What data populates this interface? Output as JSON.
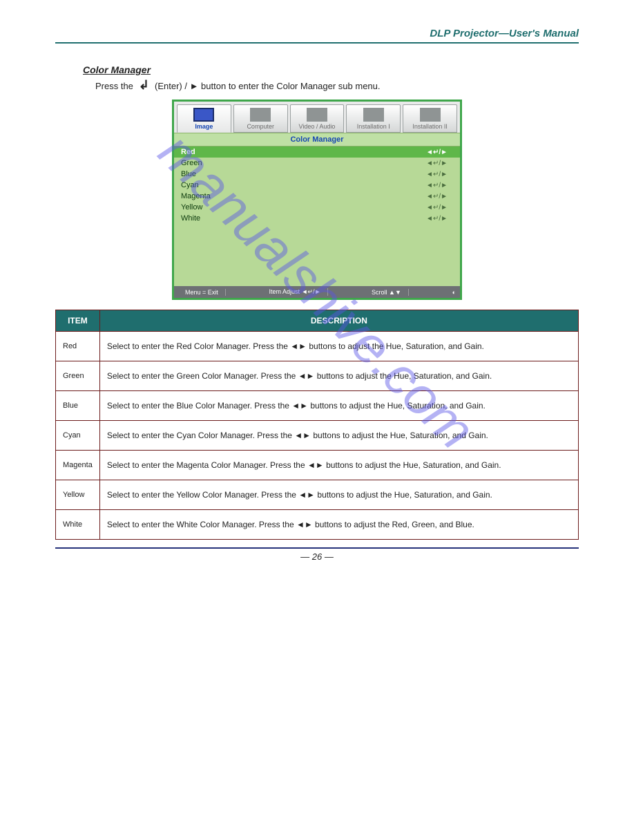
{
  "header": {
    "title": "DLP Projector—User's Manual"
  },
  "section": {
    "title": "Color Manager",
    "instruction_prefix": "Press the",
    "instruction_suffix": "(Enter) / ► button to enter the Color Manager sub menu."
  },
  "osd": {
    "tabs": [
      {
        "label": "Image",
        "active": true
      },
      {
        "label": "Computer",
        "active": false
      },
      {
        "label": "Video / Audio",
        "active": false
      },
      {
        "label": "Installation I",
        "active": false
      },
      {
        "label": "Installation II",
        "active": false
      }
    ],
    "submenu_title": "Color Manager",
    "items": [
      {
        "label": "Red",
        "selected": true
      },
      {
        "label": "Green",
        "selected": false
      },
      {
        "label": "Blue",
        "selected": false
      },
      {
        "label": "Cyan",
        "selected": false
      },
      {
        "label": "Magenta",
        "selected": false
      },
      {
        "label": "Yellow",
        "selected": false
      },
      {
        "label": "White",
        "selected": false
      }
    ],
    "footer": {
      "menu": "Menu = Exit",
      "adjust": "Item Adjust ◄↵/►",
      "scroll": "Scroll ▲▼"
    }
  },
  "table": {
    "head_item": "ITEM",
    "head_desc": "DESCRIPTION",
    "rows": [
      {
        "item": "Red",
        "desc": "Select to enter the Red Color Manager.\nPress the ◄► buttons to adjust the Hue, Saturation, and Gain."
      },
      {
        "item": "Green",
        "desc": "Select to enter the Green Color Manager.\nPress the ◄► buttons to adjust the Hue, Saturation, and Gain."
      },
      {
        "item": "Blue",
        "desc": "Select to enter the Blue Color Manager.\nPress the ◄► buttons to adjust the Hue, Saturation, and Gain."
      },
      {
        "item": "Cyan",
        "desc": "Select to enter the Cyan Color Manager.\nPress the ◄► buttons to adjust the Hue, Saturation, and Gain."
      },
      {
        "item": "Magenta",
        "desc": "Select to enter the Magenta Color Manager.\nPress the ◄► buttons to adjust the Hue, Saturation, and Gain."
      },
      {
        "item": "Yellow",
        "desc": "Select to enter the Yellow Color Manager.\nPress the ◄► buttons to adjust the Hue, Saturation, and Gain."
      },
      {
        "item": "White",
        "desc": "Select to enter the White Color Manager.\nPress the ◄► buttons to adjust the Red, Green, and Blue."
      }
    ]
  },
  "footer": {
    "page": "— 26 —"
  },
  "watermark": "manualshive.com"
}
